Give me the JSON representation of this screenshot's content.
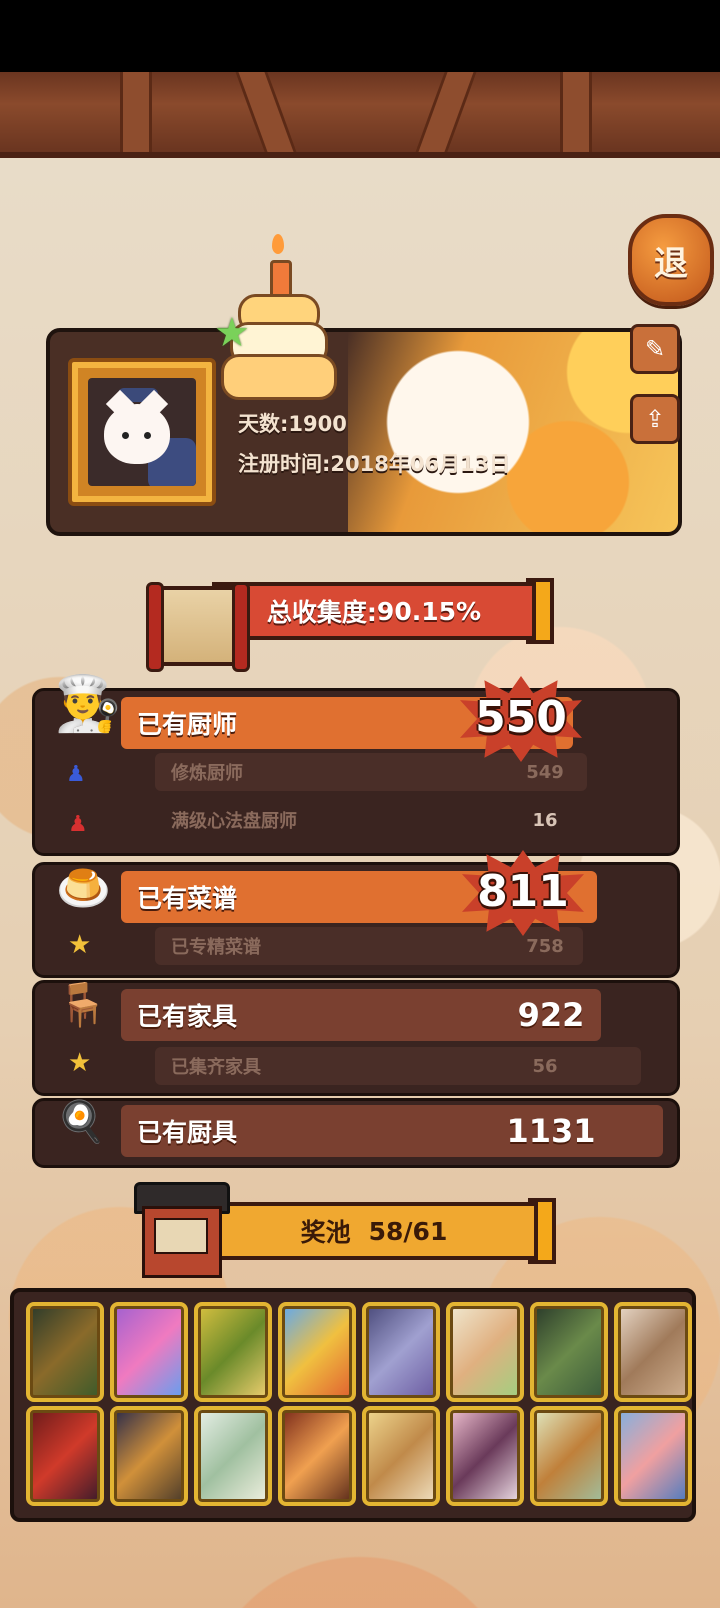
{
  "header": {
    "exit_label": "退"
  },
  "profile": {
    "days_label": "天数:",
    "days_value": "1900",
    "register_label": "注册时间:",
    "register_value": "2018年06月13日"
  },
  "collection": {
    "total_label": "总收集度:",
    "total_value": "90.15%"
  },
  "stats": {
    "chefs": {
      "label": "已有厨师",
      "value": "550",
      "subs": [
        {
          "label": "修炼厨师",
          "value": "549"
        },
        {
          "label": "满级心法盘厨师",
          "value": "16"
        }
      ]
    },
    "recipes": {
      "label": "已有菜谱",
      "value": "811",
      "subs": [
        {
          "label": "已专精菜谱",
          "value": "758"
        }
      ]
    },
    "furniture": {
      "label": "已有家具",
      "value": "922",
      "subs": [
        {
          "label": "已集齐家具",
          "value": "56"
        }
      ]
    },
    "utensils": {
      "label": "已有厨具",
      "value": "1131"
    }
  },
  "prize_pool": {
    "label": "奖池",
    "value": "58/61"
  },
  "colors": {
    "accent_orange": "#e07030",
    "panel_dark": "#3a2420",
    "banner_red": "#d84a34",
    "gold": "#e3b532"
  }
}
